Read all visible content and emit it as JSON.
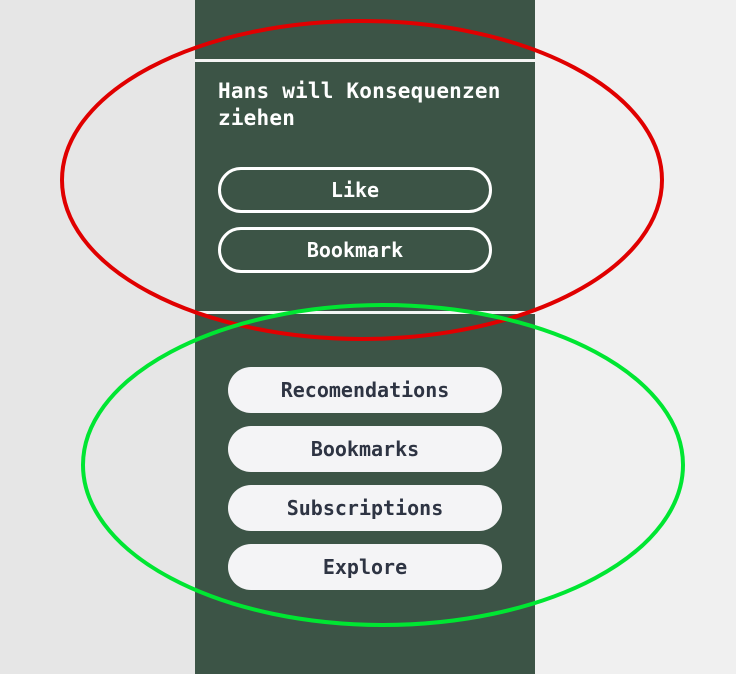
{
  "post": {
    "title": "Hans will Konsequenzen ziehen",
    "like_label": "Like",
    "bookmark_label": "Bookmark"
  },
  "nav": {
    "items": [
      {
        "label": "Recomendations"
      },
      {
        "label": "Bookmarks"
      },
      {
        "label": "Subscriptions"
      },
      {
        "label": "Explore"
      }
    ]
  },
  "colors": {
    "sidebar": "#3c5446",
    "page_left": "#e6e6e6",
    "page_right": "#f0f0f0",
    "nav_button_bg": "#f4f4f6",
    "nav_button_text": "#2e3443",
    "highlight_red": "#e00000",
    "highlight_green": "#00e632"
  }
}
